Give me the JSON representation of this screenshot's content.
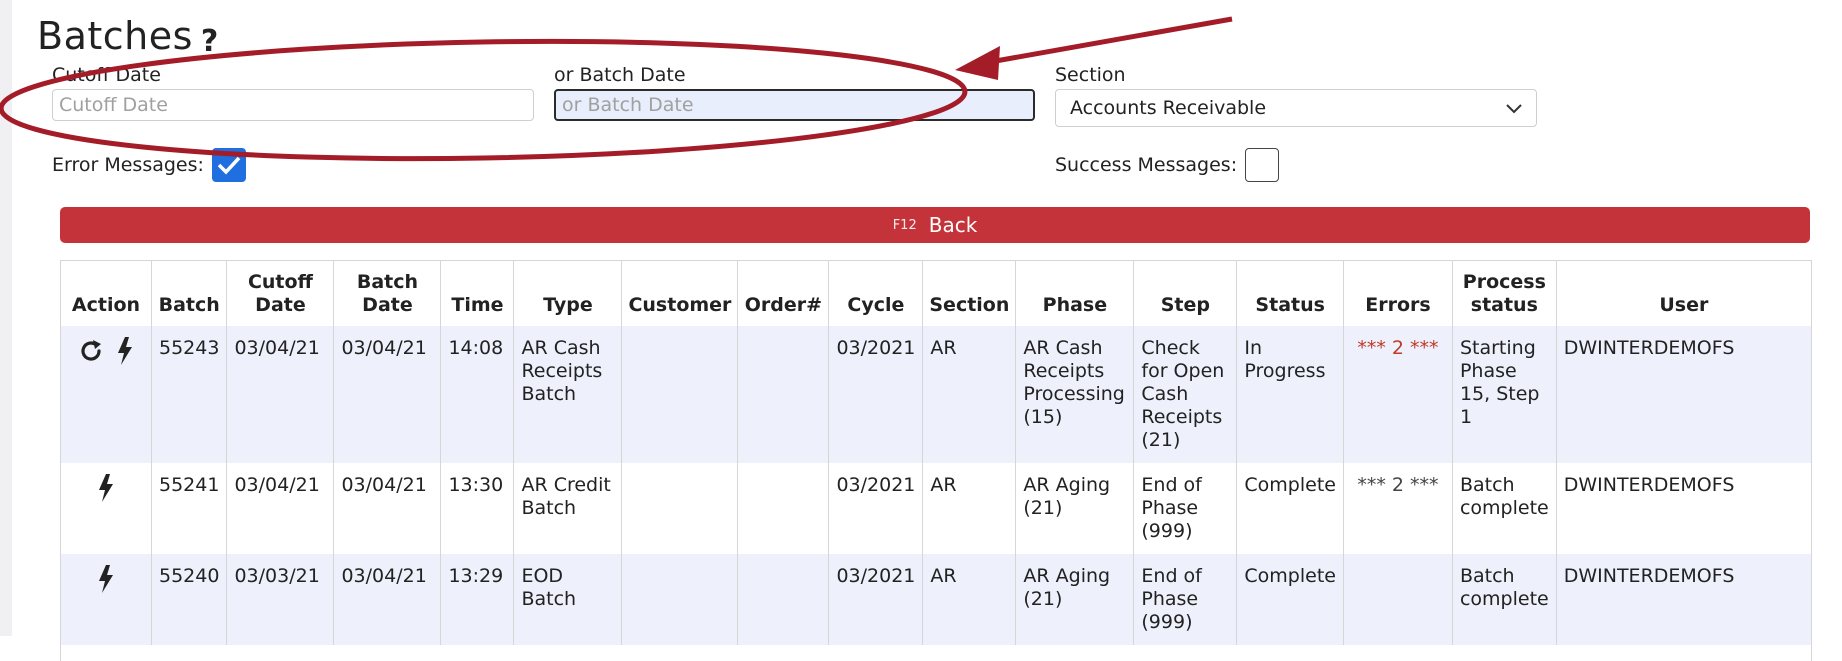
{
  "page": {
    "title": "Batches",
    "help_icon": "?"
  },
  "filters": {
    "cutoff_label": "Cutoff Date",
    "cutoff_placeholder": "Cutoff Date",
    "batch_label": "or Batch Date",
    "batch_placeholder": "or Batch Date",
    "section_label": "Section",
    "section_value": "Accounts Receivable",
    "error_label": "Error Messages:",
    "error_checked": true,
    "success_label": "Success Messages:",
    "success_checked": false
  },
  "back_button": {
    "key": "F12",
    "label": "Back"
  },
  "table": {
    "headers": [
      "Action",
      "Batch",
      "Cutoff Date",
      "Batch Date",
      "Time",
      "Type",
      "Customer",
      "Order#",
      "Cycle",
      "Section",
      "Phase",
      "Step",
      "Status",
      "Errors",
      "Process status",
      "User"
    ],
    "rows": [
      {
        "actions": [
          "refresh-icon",
          "lightning-icon"
        ],
        "batch": "55243",
        "cutoff": "03/04/21",
        "batch_date": "03/04/21",
        "time": "14:08",
        "type": "AR Cash Receipts Batch",
        "customer": "",
        "order": "",
        "cycle": "03/2021",
        "section": "AR",
        "phase": "AR Cash Receipts Processing (15)",
        "step": "Check for Open Cash Receipts (21)",
        "status": "In Progress",
        "errors": "*** 2 ***",
        "process_status": "Starting Phase 15, Step 1",
        "user": "DWINTERDEMOFS"
      },
      {
        "actions": [
          "lightning-icon"
        ],
        "batch": "55241",
        "cutoff": "03/04/21",
        "batch_date": "03/04/21",
        "time": "13:30",
        "type": "AR Credit Batch",
        "customer": "",
        "order": "",
        "cycle": "03/2021",
        "section": "AR",
        "phase": "AR Aging (21)",
        "step": "End of Phase (999)",
        "status": "Complete",
        "errors": "*** 2 ***",
        "process_status": "Batch complete",
        "user": "DWINTERDEMOFS"
      },
      {
        "actions": [
          "lightning-icon"
        ],
        "batch": "55240",
        "cutoff": "03/03/21",
        "batch_date": "03/04/21",
        "time": "13:29",
        "type": "EOD Batch",
        "customer": "",
        "order": "",
        "cycle": "03/2021",
        "section": "AR",
        "phase": "AR Aging (21)",
        "step": "End of Phase (999)",
        "status": "Complete",
        "errors": "",
        "process_status": "Batch complete",
        "user": "DWINTERDEMOFS"
      }
    ]
  },
  "colors": {
    "accent_red": "#c5333a",
    "annotation_red": "#a31c28",
    "checkbox_blue": "#1f6fe0",
    "row_stripe": "#eef0fb"
  }
}
